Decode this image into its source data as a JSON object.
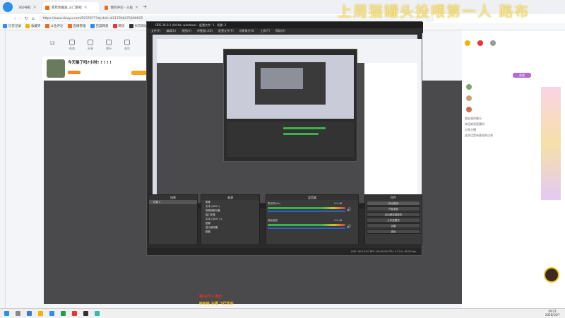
{
  "browser": {
    "tabs": [
      {
        "label": "360导航"
      },
      {
        "label": "累死你最爱_斗门游戏"
      },
      {
        "label": "我的评论 - 斗鱼"
      }
    ],
    "url": "https://www.douyu.com/9237077?dyshid=b217006475400925",
    "bookmarks": [
      "历史记录",
      "收藏夹",
      "斗鱼评论",
      "直播管理",
      "百度网盘",
      "网页",
      "抖音商城",
      "淘宝",
      "阿里巴巴",
      "原神",
      "京东PLUS",
      "游戏开发中心",
      "小游戏",
      "游戏推荐",
      "Life Force"
    ]
  },
  "overlay_title": "上周猫罐头投喂第一人 路布",
  "stream": {
    "title": "今天猫了吗?小时! ! ! ! !",
    "nav": [
      "12",
      "任务",
      "分享",
      "排行",
      "关注"
    ]
  },
  "obs": {
    "window_title": "OBS 26.0.2 (64 bit, windows) - 配置文件: 1 - 场景: 2",
    "menu": [
      "文件(F)",
      "编辑(E)",
      "视图(V)",
      "停靠窗口(D)",
      "配置文件(P)",
      "场景集合(S)",
      "工具(T)",
      "帮助(H)"
    ],
    "scenes_header": "场景",
    "scenes_dock_header": "源场景",
    "sources_header": "来源",
    "mixer_header": "混音器",
    "controls_header": "控件",
    "sources": [
      "图像",
      "文本 (GDI+)",
      "视频捕获设备",
      "窗口采集",
      "文本 (GDI+) 2",
      "图像",
      "显示器采集",
      "图像"
    ],
    "scene_label": "场景 2",
    "mixer": [
      {
        "name": "麦克风/Aux",
        "db": "0.0 dB"
      },
      {
        "name": "桌面音频",
        "db": "0.0 dB"
      }
    ],
    "controls": [
      "停止推流",
      "开始录制",
      "启动虚拟摄像机",
      "工作室模式",
      "设置",
      "退出"
    ],
    "status": "LIVE: 00:10:20   REC: 00:00:00   CPU: 17.1%, 60.00 fps"
  },
  "chat": {
    "badge_label": "贵宾",
    "messages": [
      "超宏观的聊天",
      "欢迎来到直播间",
      "分享主播",
      "这些话是有意思的过来"
    ]
  },
  "taskbar": {
    "time": "09:21",
    "date": "2020/10/7"
  },
  "red_label_1": "第18十人发出",
  "red_label_2": "哈哈哈 主播 飞行欢迎"
}
